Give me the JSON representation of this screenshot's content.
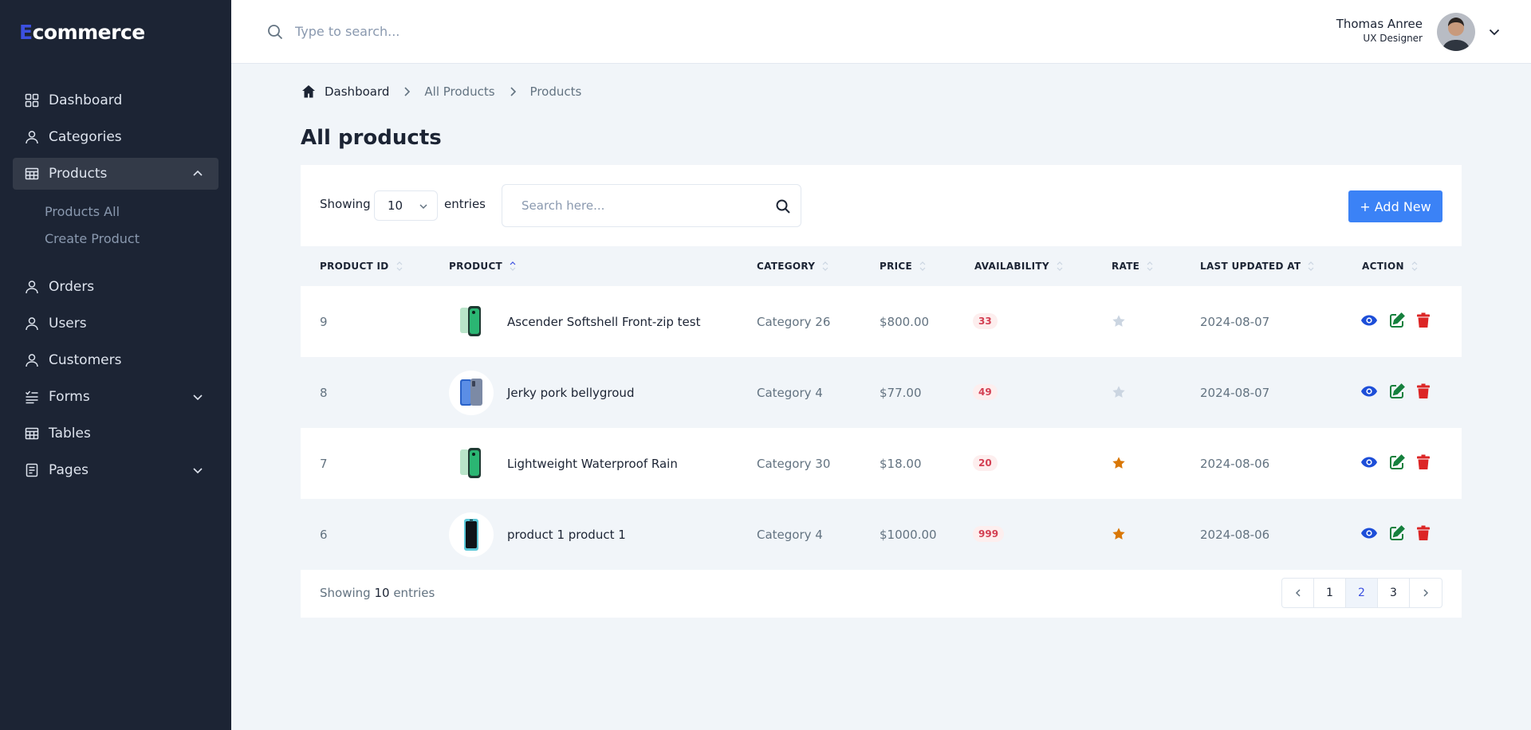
{
  "brand": {
    "initial": "E",
    "rest": "commerce"
  },
  "sidebar": {
    "items": [
      {
        "label": "Dashboard",
        "icon": "grid-icon"
      },
      {
        "label": "Categories",
        "icon": "user-icon"
      },
      {
        "label": "Products",
        "icon": "table-icon",
        "expanded": true
      },
      {
        "label": "Orders",
        "icon": "user-icon"
      },
      {
        "label": "Users",
        "icon": "user-icon"
      },
      {
        "label": "Customers",
        "icon": "user-icon"
      },
      {
        "label": "Forms",
        "icon": "forms-icon"
      },
      {
        "label": "Tables",
        "icon": "table-icon"
      },
      {
        "label": "Pages",
        "icon": "pages-icon"
      }
    ],
    "sub_items": [
      "Products All",
      "Create Product"
    ]
  },
  "header": {
    "search_placeholder": "Type to search...",
    "user_name": "Thomas Anree",
    "user_role": "UX Designer"
  },
  "breadcrumb": [
    "Dashboard",
    "All Products",
    "Products"
  ],
  "page_title": "All products",
  "toolbar": {
    "showing_label": "Showing",
    "entries_value": "10",
    "entries_label": "entries",
    "search_placeholder": "Search here...",
    "add_label": "+ Add New"
  },
  "table": {
    "columns": [
      "PRODUCT ID",
      "PRODUCT",
      "CATEGORY",
      "PRICE",
      "AVAILABILITY",
      "RATE",
      "LAST UPDATED AT",
      "ACTION"
    ],
    "sorted_column": "PRODUCT",
    "rows": [
      {
        "id": "9",
        "name": "Ascender Softshell Front-zip test",
        "category": "Category 26",
        "price": "$800.00",
        "availability": "33",
        "rated": false,
        "updated": "2024-08-07",
        "thumb": "green-phone"
      },
      {
        "id": "8",
        "name": "Jerky pork bellygroud",
        "category": "Category 4",
        "price": "$77.00",
        "availability": "49",
        "rated": false,
        "updated": "2024-08-07",
        "thumb": "blue-phone"
      },
      {
        "id": "7",
        "name": "Lightweight Waterproof Rain",
        "category": "Category 30",
        "price": "$18.00",
        "availability": "20",
        "rated": true,
        "updated": "2024-08-06",
        "thumb": "green-phone"
      },
      {
        "id": "6",
        "name": "product 1 product 1",
        "category": "Category 4",
        "price": "$1000.00",
        "availability": "999",
        "rated": true,
        "updated": "2024-08-06",
        "thumb": "black-phone"
      }
    ]
  },
  "footer": {
    "showing_prefix": "Showing",
    "showing_count": "10",
    "showing_suffix": "entries"
  },
  "pagination": {
    "pages": [
      "1",
      "2",
      "3"
    ],
    "active": "2"
  },
  "colors": {
    "sidebar": "#1c2434",
    "accent": "#3b82f6",
    "star_on": "#d97706",
    "star_off": "#cbd5e1",
    "view": "#1d4ed8",
    "edit": "#15803d",
    "delete": "#dc2626"
  }
}
